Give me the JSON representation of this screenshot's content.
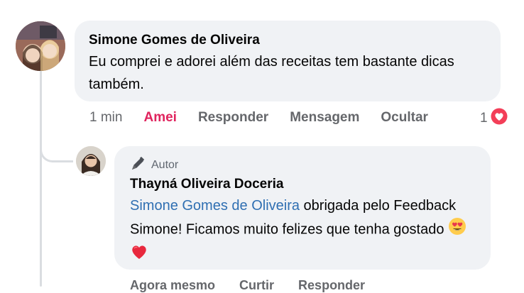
{
  "main_comment": {
    "author": "Simone Gomes de Oliveira",
    "text": "Eu comprei e adorei além das receitas tem bastante dicas também.",
    "actions": {
      "time": "1 min",
      "like": "Amei",
      "reply": "Responder",
      "message": "Mensagem",
      "hide": "Ocultar"
    },
    "reaction_count": "1",
    "reaction_icon": "heart-icon",
    "colors": {
      "like_active": "#e0245e",
      "reaction": "#f33e58"
    }
  },
  "reply": {
    "badge": "Autor",
    "badge_icon": "pen-icon",
    "author": "Thayná Oliveira Doceria",
    "mention": "Simone Gomes de Oliveira",
    "text": " obrigada pelo Feedback Simone! Ficamos muito felizes que tenha gostado ",
    "emojis": [
      "heart-eyes-emoji",
      "red-heart-emoji"
    ],
    "actions": {
      "time": "Agora mesmo",
      "like": "Curtir",
      "reply": "Responder"
    },
    "colors": {
      "mention": "#2f6fb2"
    }
  }
}
